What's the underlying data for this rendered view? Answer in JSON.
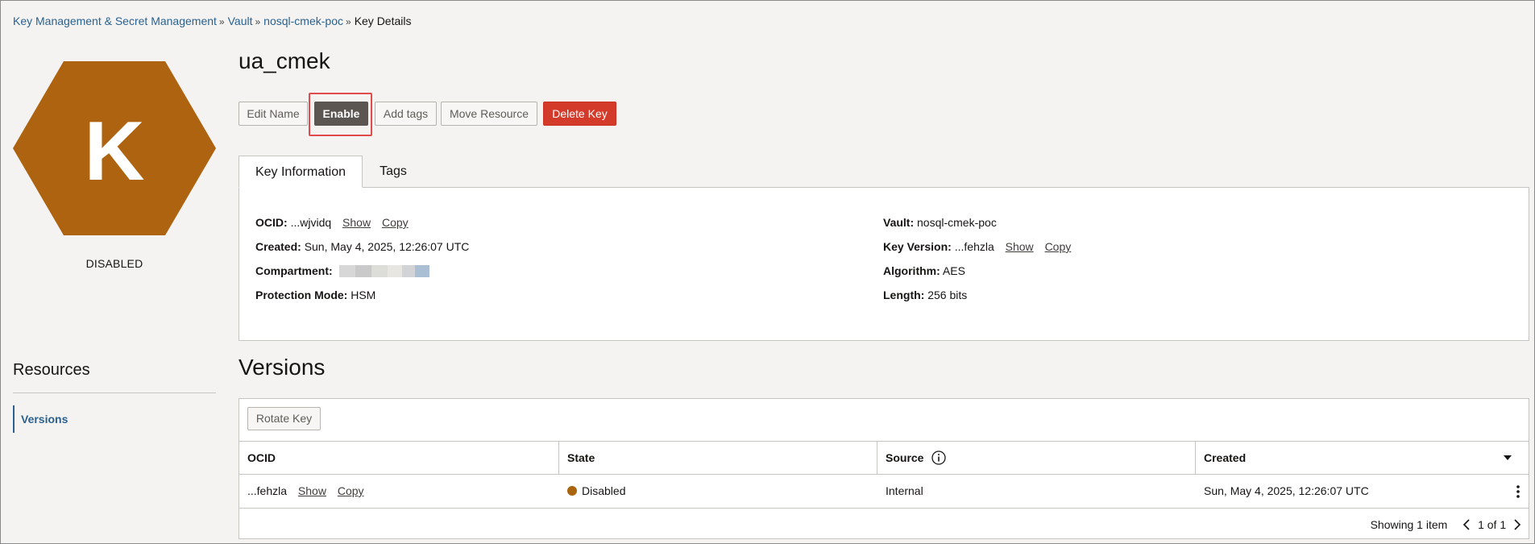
{
  "breadcrumb": {
    "items": [
      "Key Management & Secret Management",
      "Vault",
      "nosql-cmek-poc"
    ],
    "current": "Key Details",
    "separator": "»"
  },
  "key_badge": {
    "letter": "K",
    "status": "DISABLED",
    "color": "#ad6310"
  },
  "key_title": "ua_cmek",
  "actions": {
    "edit_name": "Edit Name",
    "enable": "Enable",
    "add_tags": "Add tags",
    "move_resource": "Move Resource",
    "delete_key": "Delete Key"
  },
  "tabs": {
    "key_information": "Key Information",
    "tags": "Tags"
  },
  "key_info": {
    "show_label": "Show",
    "copy_label": "Copy",
    "ocid": {
      "label": "OCID:",
      "value": "...wjvidq"
    },
    "created": {
      "label": "Created:",
      "value": "Sun, May 4, 2025, 12:26:07 UTC"
    },
    "compartment": {
      "label": "Compartment:"
    },
    "protection_mode": {
      "label": "Protection Mode:",
      "value": "HSM"
    },
    "vault": {
      "label": "Vault:",
      "value": "nosql-cmek-poc"
    },
    "key_version": {
      "label": "Key Version:",
      "value": "...fehzla"
    },
    "algorithm": {
      "label": "Algorithm:",
      "value": "AES"
    },
    "length": {
      "label": "Length:",
      "value": "256 bits"
    }
  },
  "resources": {
    "title": "Resources",
    "items": [
      "Versions"
    ]
  },
  "versions": {
    "title": "Versions",
    "rotate_key": "Rotate Key",
    "columns": [
      "OCID",
      "State",
      "Source",
      "Created"
    ],
    "rows": [
      {
        "ocid": "...fehzla",
        "show": "Show",
        "copy": "Copy",
        "state": "Disabled",
        "source": "Internal",
        "created": "Sun, May 4, 2025, 12:26:07 UTC"
      }
    ],
    "showing": "Showing 1 item",
    "page": "1 of 1"
  },
  "colors": {
    "link": "#2b6190",
    "delete": "#d33a2a",
    "disabled_state": "#a9650e",
    "highlight": "#e24b4b"
  }
}
